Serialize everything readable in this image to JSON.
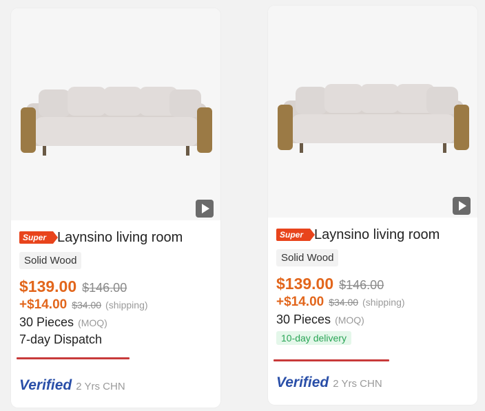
{
  "products": [
    {
      "badge": "Super",
      "title": "Laynsino living room",
      "tag": "Solid Wood",
      "price": "$139.00",
      "original_price": "$146.00",
      "shipping_price": "+$14.00",
      "shipping_original": "$34.00",
      "shipping_label": "(shipping)",
      "moq_value": "30 Pieces",
      "moq_label": "(MOQ)",
      "dispatch": "7-day Dispatch",
      "verified": "Verified",
      "years": "2 Yrs CHN",
      "video_icon": "play-icon"
    },
    {
      "badge": "Super",
      "title": "Laynsino living room",
      "tag": "Solid Wood",
      "price": "$139.00",
      "original_price": "$146.00",
      "shipping_price": "+$14.00",
      "shipping_original": "$34.00",
      "shipping_label": "(shipping)",
      "moq_value": "30 Pieces",
      "moq_label": "(MOQ)",
      "delivery": "10-day delivery",
      "verified": "Verified",
      "years": "2 Yrs CHN",
      "video_icon": "play-icon"
    }
  ],
  "colors": {
    "price": "#e2661c",
    "super_badge": "#e8441c",
    "delivery_text": "#2aa556",
    "delivery_bg": "#e4f7ea",
    "verified": "#2a4fa8",
    "annotation_underline": "#c83a3a"
  }
}
